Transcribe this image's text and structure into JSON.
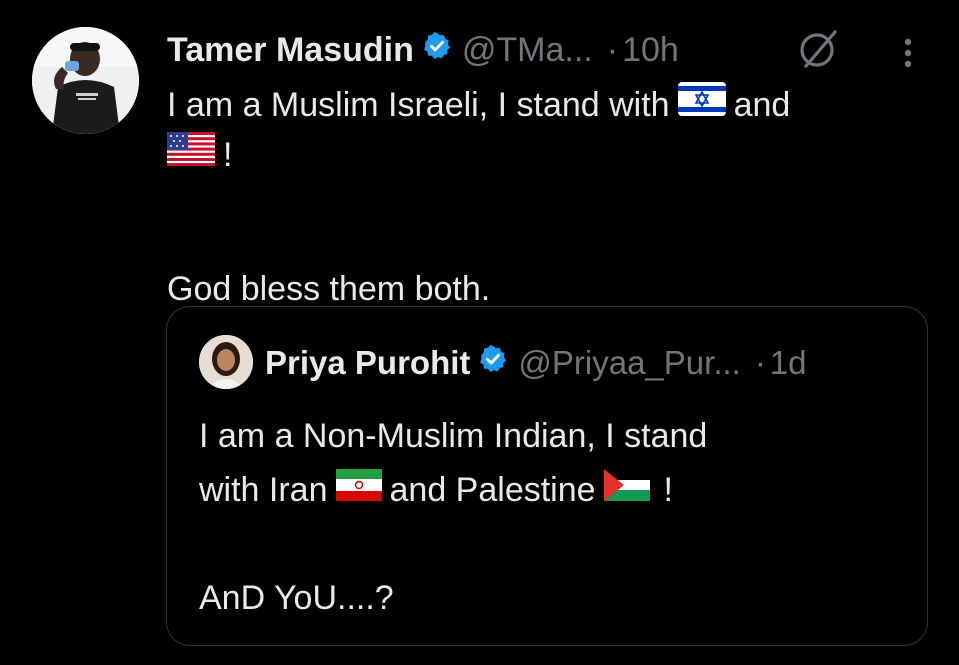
{
  "tweet": {
    "author_name": "Tamer Masudin",
    "author_handle": "@TMa...",
    "separator": "·",
    "time": "10h",
    "text_line1": "I am a Muslim Israeli, I stand with",
    "text_and": "and",
    "text_exclaim": "!",
    "text_line3": "God bless them both.",
    "flag1": "israel-flag",
    "flag2": "usa-flag",
    "icons": [
      "verified-badge-icon",
      "grok-icon",
      "more-options-icon"
    ]
  },
  "quote": {
    "author_name": "Priya Purohit",
    "author_handle": "@Priyaa_Pur...",
    "separator": "·",
    "time": "1d",
    "text_line1": "I am a Non-Muslim Indian, I stand",
    "text_with_iran": "with Iran",
    "text_and_palestine": "and Palestine",
    "text_exclaim": "!",
    "text_line4": "AnD YoU....?",
    "flag1": "iran-flag",
    "flag2": "palestine-flag"
  },
  "colors": {
    "background": "#000000",
    "text_primary": "#e7e9ea",
    "text_secondary": "#71767b",
    "verified_blue": "#1d9bf0",
    "border": "#2f3336"
  }
}
